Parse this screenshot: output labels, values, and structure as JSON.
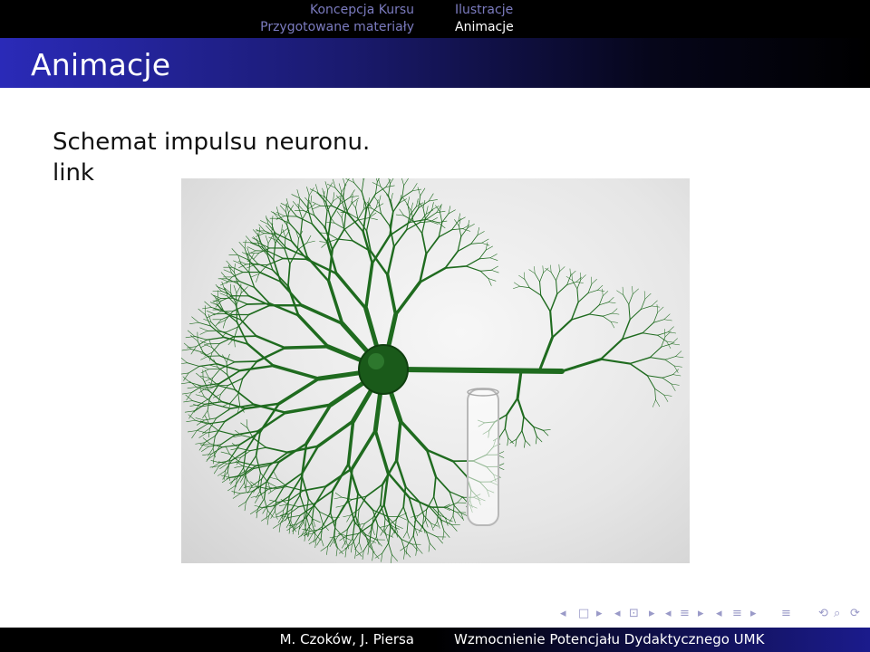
{
  "header": {
    "left_section": {
      "line1": "Koncepcja Kursu",
      "line2": "Przygotowane materiały"
    },
    "right_section": {
      "line1": "Ilustracje",
      "line2": "Animacje"
    }
  },
  "frame": {
    "title": "Animacje",
    "text_line": "Schemat impulsu neuronu.",
    "link_label": "link"
  },
  "figure": {
    "icon": "neuron-illustration",
    "colors": {
      "dendrites": "#1f6b1f",
      "soma": "#1a5a1a",
      "background": "#e6e6e6"
    }
  },
  "navigation": {
    "symbols": [
      "◂",
      "□",
      "▸",
      "◂",
      "⊡",
      "▸",
      "◂",
      "≡",
      "▸",
      "◂",
      "≡",
      "▸",
      "≡",
      "⟲",
      "⌕",
      "⟳"
    ]
  },
  "footer": {
    "authors": "M. Czoków, J. Piersa",
    "title": "Wzmocnienie Potencjału Dydaktycznego UMK"
  }
}
